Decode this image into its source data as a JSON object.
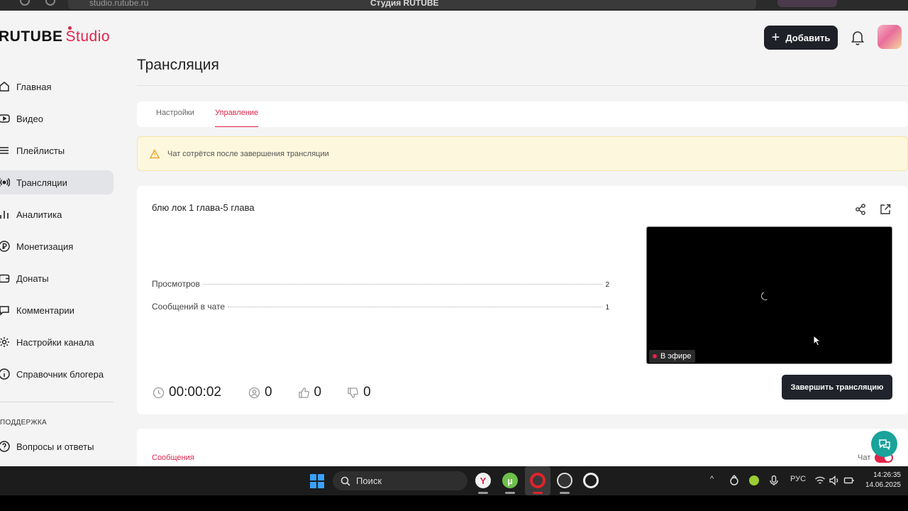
{
  "browser": {
    "url": "studio.rutube.ru",
    "window_title": "Студия RUTUBE"
  },
  "header": {
    "logo_brand": "RUTUBE",
    "logo_product": "Studio",
    "add_label": "Добавить",
    "accent_color": "#e2244a"
  },
  "sidebar": {
    "items": [
      {
        "label": "Главная",
        "icon": "home-icon"
      },
      {
        "label": "Видео",
        "icon": "video-icon"
      },
      {
        "label": "Плейлисты",
        "icon": "playlist-icon"
      },
      {
        "label": "Трансляции",
        "icon": "broadcast-icon",
        "active": true
      },
      {
        "label": "Аналитика",
        "icon": "analytics-icon"
      },
      {
        "label": "Монетизация",
        "icon": "ruble-icon"
      },
      {
        "label": "Донаты",
        "icon": "wallet-icon"
      },
      {
        "label": "Комментарии",
        "icon": "comment-icon"
      },
      {
        "label": "Настройки канала",
        "icon": "gear-icon"
      },
      {
        "label": "Справочник блогера",
        "icon": "info-icon"
      }
    ],
    "support_heading": "ПОДДЕРЖКА",
    "support_items": [
      {
        "label": "Вопросы и ответы",
        "icon": "question-icon"
      }
    ]
  },
  "main": {
    "page_title": "Трансляция",
    "tabs": [
      {
        "label": "Настройки",
        "active": false
      },
      {
        "label": "Управление",
        "active": true
      }
    ],
    "warning": "Чат сотрётся после завершения трансляции",
    "stream": {
      "title": "блю лок 1 глава-5 глава",
      "stats": [
        {
          "label": "Просмотров",
          "value": "2"
        },
        {
          "label": "Сообщений в чате",
          "value": "1"
        }
      ],
      "timer": "00:00:02",
      "viewers": "0",
      "likes": "0",
      "dislikes": "0",
      "live_badge": "В эфире",
      "end_button": "Завершить трансляцию"
    },
    "messages": {
      "tab_label": "Сообщения",
      "chat_label": "Чат",
      "chat_enabled": true
    }
  },
  "taskbar": {
    "search_placeholder": "Поиск",
    "language": "РУС",
    "time": "14:26:35",
    "date": "14.06.2025"
  }
}
